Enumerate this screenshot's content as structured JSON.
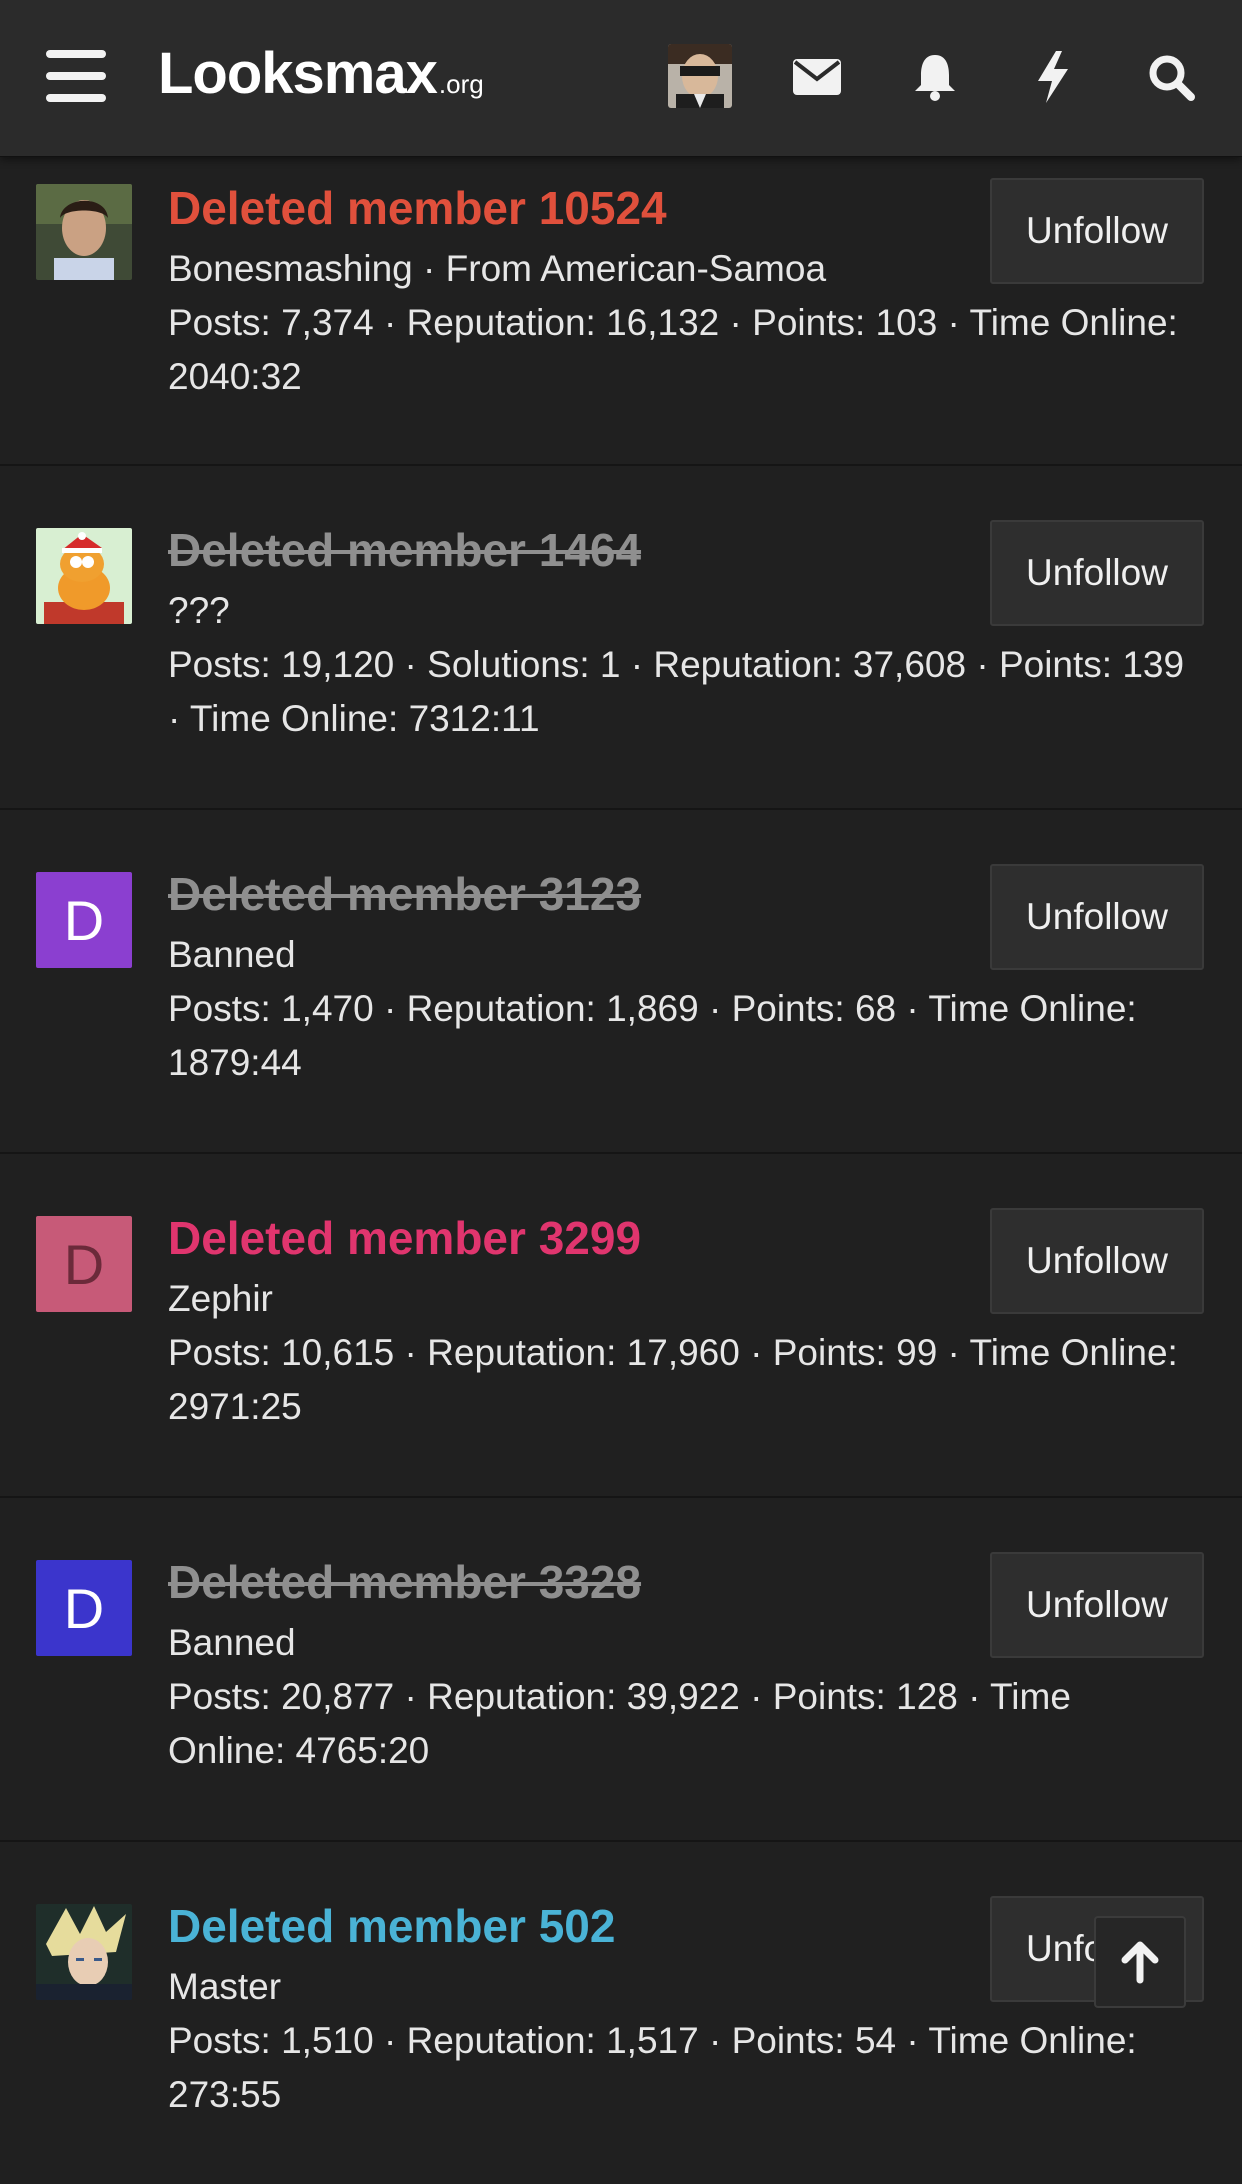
{
  "header": {
    "logo_text": "Looksmax",
    "logo_domain": ".org",
    "icons": [
      "menu-icon",
      "envelope-icon",
      "bell-icon",
      "bolt-icon",
      "search-icon"
    ]
  },
  "members": [
    {
      "name": "Deleted member 10524",
      "name_color": "#e0503c",
      "struck": false,
      "title": "Bonesmashing · From American-Samoa",
      "stats": "Posts: 7,374 · Reputation: 16,132 · Points: 103 · Time Online: 2040:32",
      "button": "Unfollow",
      "avatar": "photo"
    },
    {
      "name": "Deleted member 1464",
      "name_color": "#8f8f8f",
      "struck": true,
      "title": "???",
      "stats": "Posts: 19,120 · Solutions: 1 · Reputation: 37,608 · Points: 139 · Time Online: 7312:11",
      "button": "Unfollow",
      "avatar": "cartoon-cat"
    },
    {
      "name": "Deleted member 3123",
      "name_color": "#8f8f8f",
      "struck": true,
      "title": "Banned",
      "stats": "Posts: 1,470 · Reputation: 1,869 · Points: 68 · Time Online: 1879:44",
      "button": "Unfollow",
      "avatar_letter": "D",
      "avatar_color": "#8b3fd0"
    },
    {
      "name": "Deleted member 3299",
      "name_color": "#e0356e",
      "struck": false,
      "title": "Zephir",
      "stats": "Posts: 10,615 · Reputation: 17,960 · Points: 99 · Time Online: 2971:25",
      "button": "Unfollow",
      "avatar_letter": "D",
      "avatar_color": "#c75a78"
    },
    {
      "name": "Deleted member 3328",
      "name_color": "#8f8f8f",
      "struck": true,
      "title": "Banned",
      "stats": "Posts: 20,877 · Reputation: 39,922 · Points: 128 · Time Online: 4765:20",
      "button": "Unfollow",
      "avatar_letter": "D",
      "avatar_color": "#3b35cc"
    },
    {
      "name": "Deleted member 502",
      "name_color": "#4ab3d6",
      "struck": false,
      "title": "Master",
      "stats": "Posts: 1,510 · Reputation: 1,517 · Points: 54 · Time Online: 273:55",
      "button": "Unfollow",
      "avatar": "anime"
    }
  ]
}
